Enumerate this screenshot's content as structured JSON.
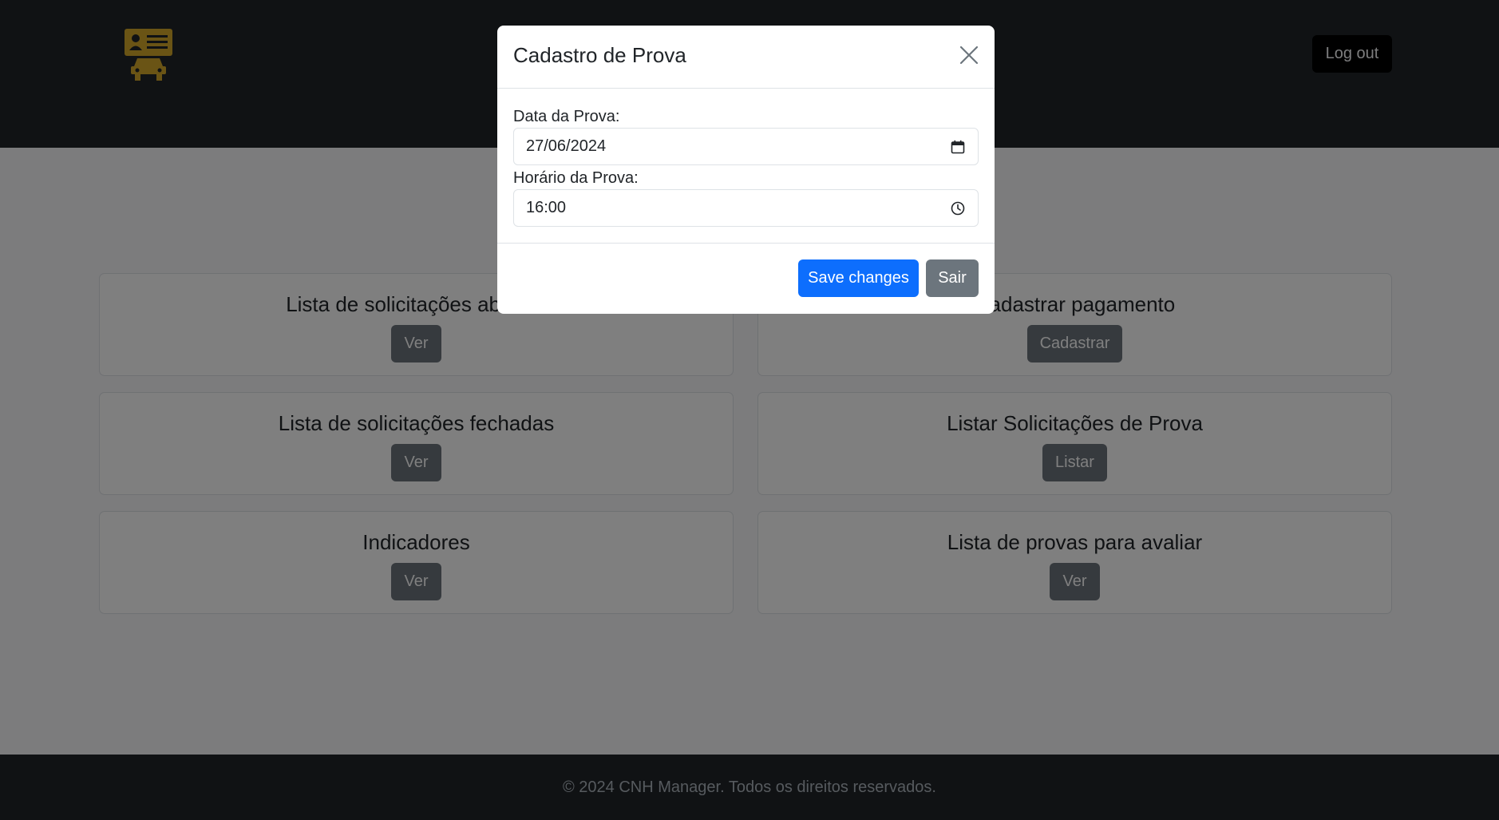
{
  "header": {
    "logo_icon": "id-card-car-icon",
    "logo_color": "#d4a82a",
    "logout_label": "Log out"
  },
  "cards": [
    {
      "title": "Lista de solicitações abertas",
      "button_label": "Ver"
    },
    {
      "title": "Cadastrar pagamento",
      "button_label": "Cadastrar"
    },
    {
      "title": "Lista de solicitações fechadas",
      "button_label": "Ver"
    },
    {
      "title": "Listar Solicitações de Prova",
      "button_label": "Listar"
    },
    {
      "title": "Indicadores",
      "button_label": "Ver"
    },
    {
      "title": "Lista de provas para avaliar",
      "button_label": "Ver"
    }
  ],
  "footer": {
    "text": "© 2024 CNH Manager. Todos os direitos reservados."
  },
  "modal": {
    "title": "Cadastro de Prova",
    "date_label": "Data da Prova:",
    "date_value": "27/06/2024",
    "time_label": "Horário da Prova:",
    "time_value": "16:00",
    "save_label": "Save changes",
    "exit_label": "Sair"
  },
  "colors": {
    "header_bg": "#212529",
    "primary": "#0d6efd",
    "secondary": "#6c757d"
  }
}
